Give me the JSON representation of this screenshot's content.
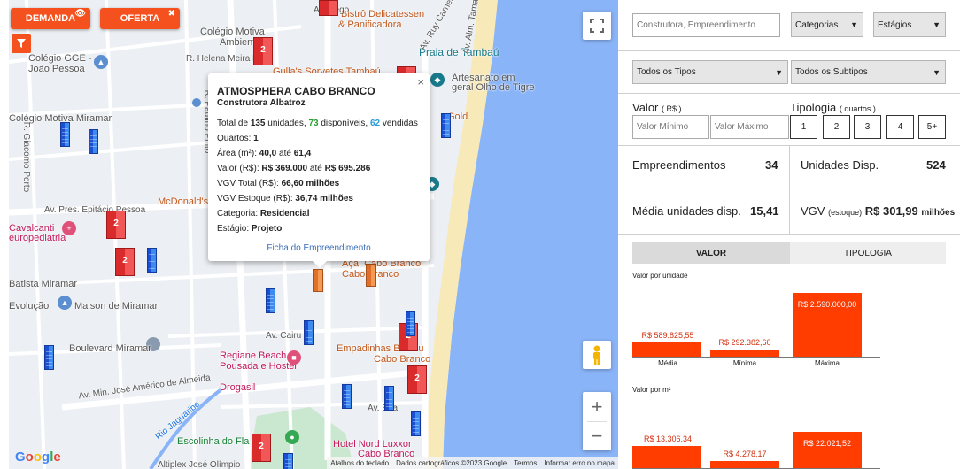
{
  "map": {
    "demanda_label": "DEMANDA",
    "oferta_label": "OFERTA",
    "labels": [
      {
        "t": "Bistrô Delicatessen",
        "cls": "orange"
      },
      {
        "t": "& Panificadora",
        "cls": "orange"
      },
      {
        "t": "Colégio Motiva",
        "cls": ""
      },
      {
        "t": "Ambiente",
        "cls": ""
      },
      {
        "t": "R. Helena Meira Lima",
        "cls": "sm"
      },
      {
        "t": "Colégio GGE -",
        "cls": ""
      },
      {
        "t": "João Pessoa",
        "cls": ""
      },
      {
        "t": "Gulla's Sorvetes Tambaú",
        "cls": "orange"
      },
      {
        "t": "Praia de Tambaú",
        "cls": "teal"
      },
      {
        "t": "Artesanato em",
        "cls": ""
      },
      {
        "t": "geral Olho de Tigre",
        "cls": ""
      },
      {
        "t": "Colégio Motiva Miramar",
        "cls": ""
      },
      {
        "t": "R. Giacomo Porto",
        "cls": "sm"
      },
      {
        "t": "R. Paulino Pinto",
        "cls": "sm"
      },
      {
        "t": "Av. Pres. Epitácio Pessoa",
        "cls": "sm"
      },
      {
        "t": "McDonald's",
        "cls": "orange"
      },
      {
        "t": "Cavalcanti",
        "cls": "pink"
      },
      {
        "t": "europediatria",
        "cls": "pink"
      },
      {
        "t": "Batista Miramar",
        "cls": ""
      },
      {
        "t": "Evolução",
        "cls": ""
      },
      {
        "t": "Maison de Miramar",
        "cls": ""
      },
      {
        "t": "Boulevard Miramar",
        "cls": ""
      },
      {
        "t": "Av. Cairu",
        "cls": "sm"
      },
      {
        "t": "Açaí Cabo Branco",
        "cls": "orange"
      },
      {
        "t": "Empadinhas Babalu",
        "cls": "orange"
      },
      {
        "t": "Cabo Branco",
        "cls": "orange"
      },
      {
        "t": "Regiane Beach",
        "cls": "pink"
      },
      {
        "t": "Pousada e Hostel",
        "cls": "pink"
      },
      {
        "t": "Av. Min. José Américo de Almeida",
        "cls": "sm"
      },
      {
        "t": "Drogasil",
        "cls": "pink"
      },
      {
        "t": "Rio Jaguaribe",
        "cls": "blue"
      },
      {
        "t": "Av. Bua",
        "cls": "sm"
      },
      {
        "t": "Escolinha do Fla",
        "cls": "green"
      },
      {
        "t": "Hotel Nord Luxxor",
        "cls": "pink"
      },
      {
        "t": "Cabo Branco",
        "cls": "pink"
      },
      {
        "t": "Altiplex José Olímpio",
        "cls": "sm"
      },
      {
        "t": "Av. Nego",
        "cls": "sm"
      },
      {
        "t": "Av. Ruy Carneiro",
        "cls": "sm"
      },
      {
        "t": "Av. Alm. Tamandaré",
        "cls": "sm"
      },
      {
        "t": "Gold",
        "cls": "orange"
      },
      {
        "t": "Cabo Branco",
        "cls": "orange"
      }
    ],
    "google_logo": "Google",
    "attribution": [
      "Atalhos do teclado",
      "Dados cartográficos ©2023 Google",
      "Termos",
      "Informar erro no mapa"
    ]
  },
  "popup": {
    "title": "ATMOSPHERA CABO BRANCO",
    "builder": "Construtora Albatroz",
    "total_prefix": "Total de ",
    "total_units": "135",
    "total_mid": " unidades, ",
    "available": "73",
    "available_suffix": " disponíveis, ",
    "sold": "62",
    "sold_suffix": " vendidas",
    "quartos_label": "Quartos: ",
    "quartos": "1",
    "area_label": "Área (m²): ",
    "area_min": "40,0",
    "area_mid": " até ",
    "area_max": "61,4",
    "valor_label": "Valor (R$): ",
    "valor_min": "R$ 369.000",
    "valor_mid": " até ",
    "valor_max": "R$ 695.286",
    "vgv_total_label": "VGV Total (R$): ",
    "vgv_total": "66,60 milhões",
    "vgv_estoque_label": "VGV Estoque (R$): ",
    "vgv_estoque": "36,74 milhões",
    "categoria_label": "Categoria: ",
    "categoria": "Residencial",
    "estagio_label": "Estágio: ",
    "estagio": "Projeto",
    "link": "Ficha do Empreendimento"
  },
  "filters": {
    "search_placeholder": "Construtora, Empreendimento",
    "categorias": "Categorias",
    "estagios": "Estágios",
    "tipos": "Todos os Tipos",
    "subtipos": "Todos os Subtipos",
    "valor_label": "Valor",
    "valor_unit": "( R$ )",
    "tipologia_label": "Tipologia",
    "tipologia_unit": "( quartos )",
    "valor_min_placeholder": "Valor Mínimo",
    "valor_max_placeholder": "Valor Máximo",
    "quartos": [
      "1",
      "2",
      "3",
      "4",
      "5+"
    ]
  },
  "stats": {
    "empreendimentos_label": "Empreendimentos",
    "empreendimentos": "34",
    "unidades_label": "Unidades Disp.",
    "unidades": "524",
    "media_label": "Média unidades disp.",
    "media": "15,41",
    "vgv_label": "VGV",
    "vgv_sub": "(estoque)",
    "vgv_value": "R$ 301,99",
    "vgv_unit": "milhões"
  },
  "tabs": [
    "VALOR",
    "TIPOLOGIA"
  ],
  "chart_data": [
    {
      "type": "bar",
      "title": "Valor por unidade",
      "categories": [
        "Média",
        "Mínima",
        "Máxima"
      ],
      "values": [
        589825.55,
        292382.6,
        2590000.0
      ],
      "labels": [
        "R$ 589.825,55",
        "R$ 292.382,60",
        "R$ 2.590.000,00"
      ],
      "color": "#ff3d00"
    },
    {
      "type": "bar",
      "title": "Valor por m²",
      "categories": [
        "Média",
        "Mínima",
        "Máxima"
      ],
      "values": [
        13306.34,
        4278.17,
        22021.52
      ],
      "labels": [
        "R$ 13.306,34",
        "R$ 4.278,17",
        "R$ 22.021,52"
      ],
      "color": "#ff3d00"
    }
  ]
}
